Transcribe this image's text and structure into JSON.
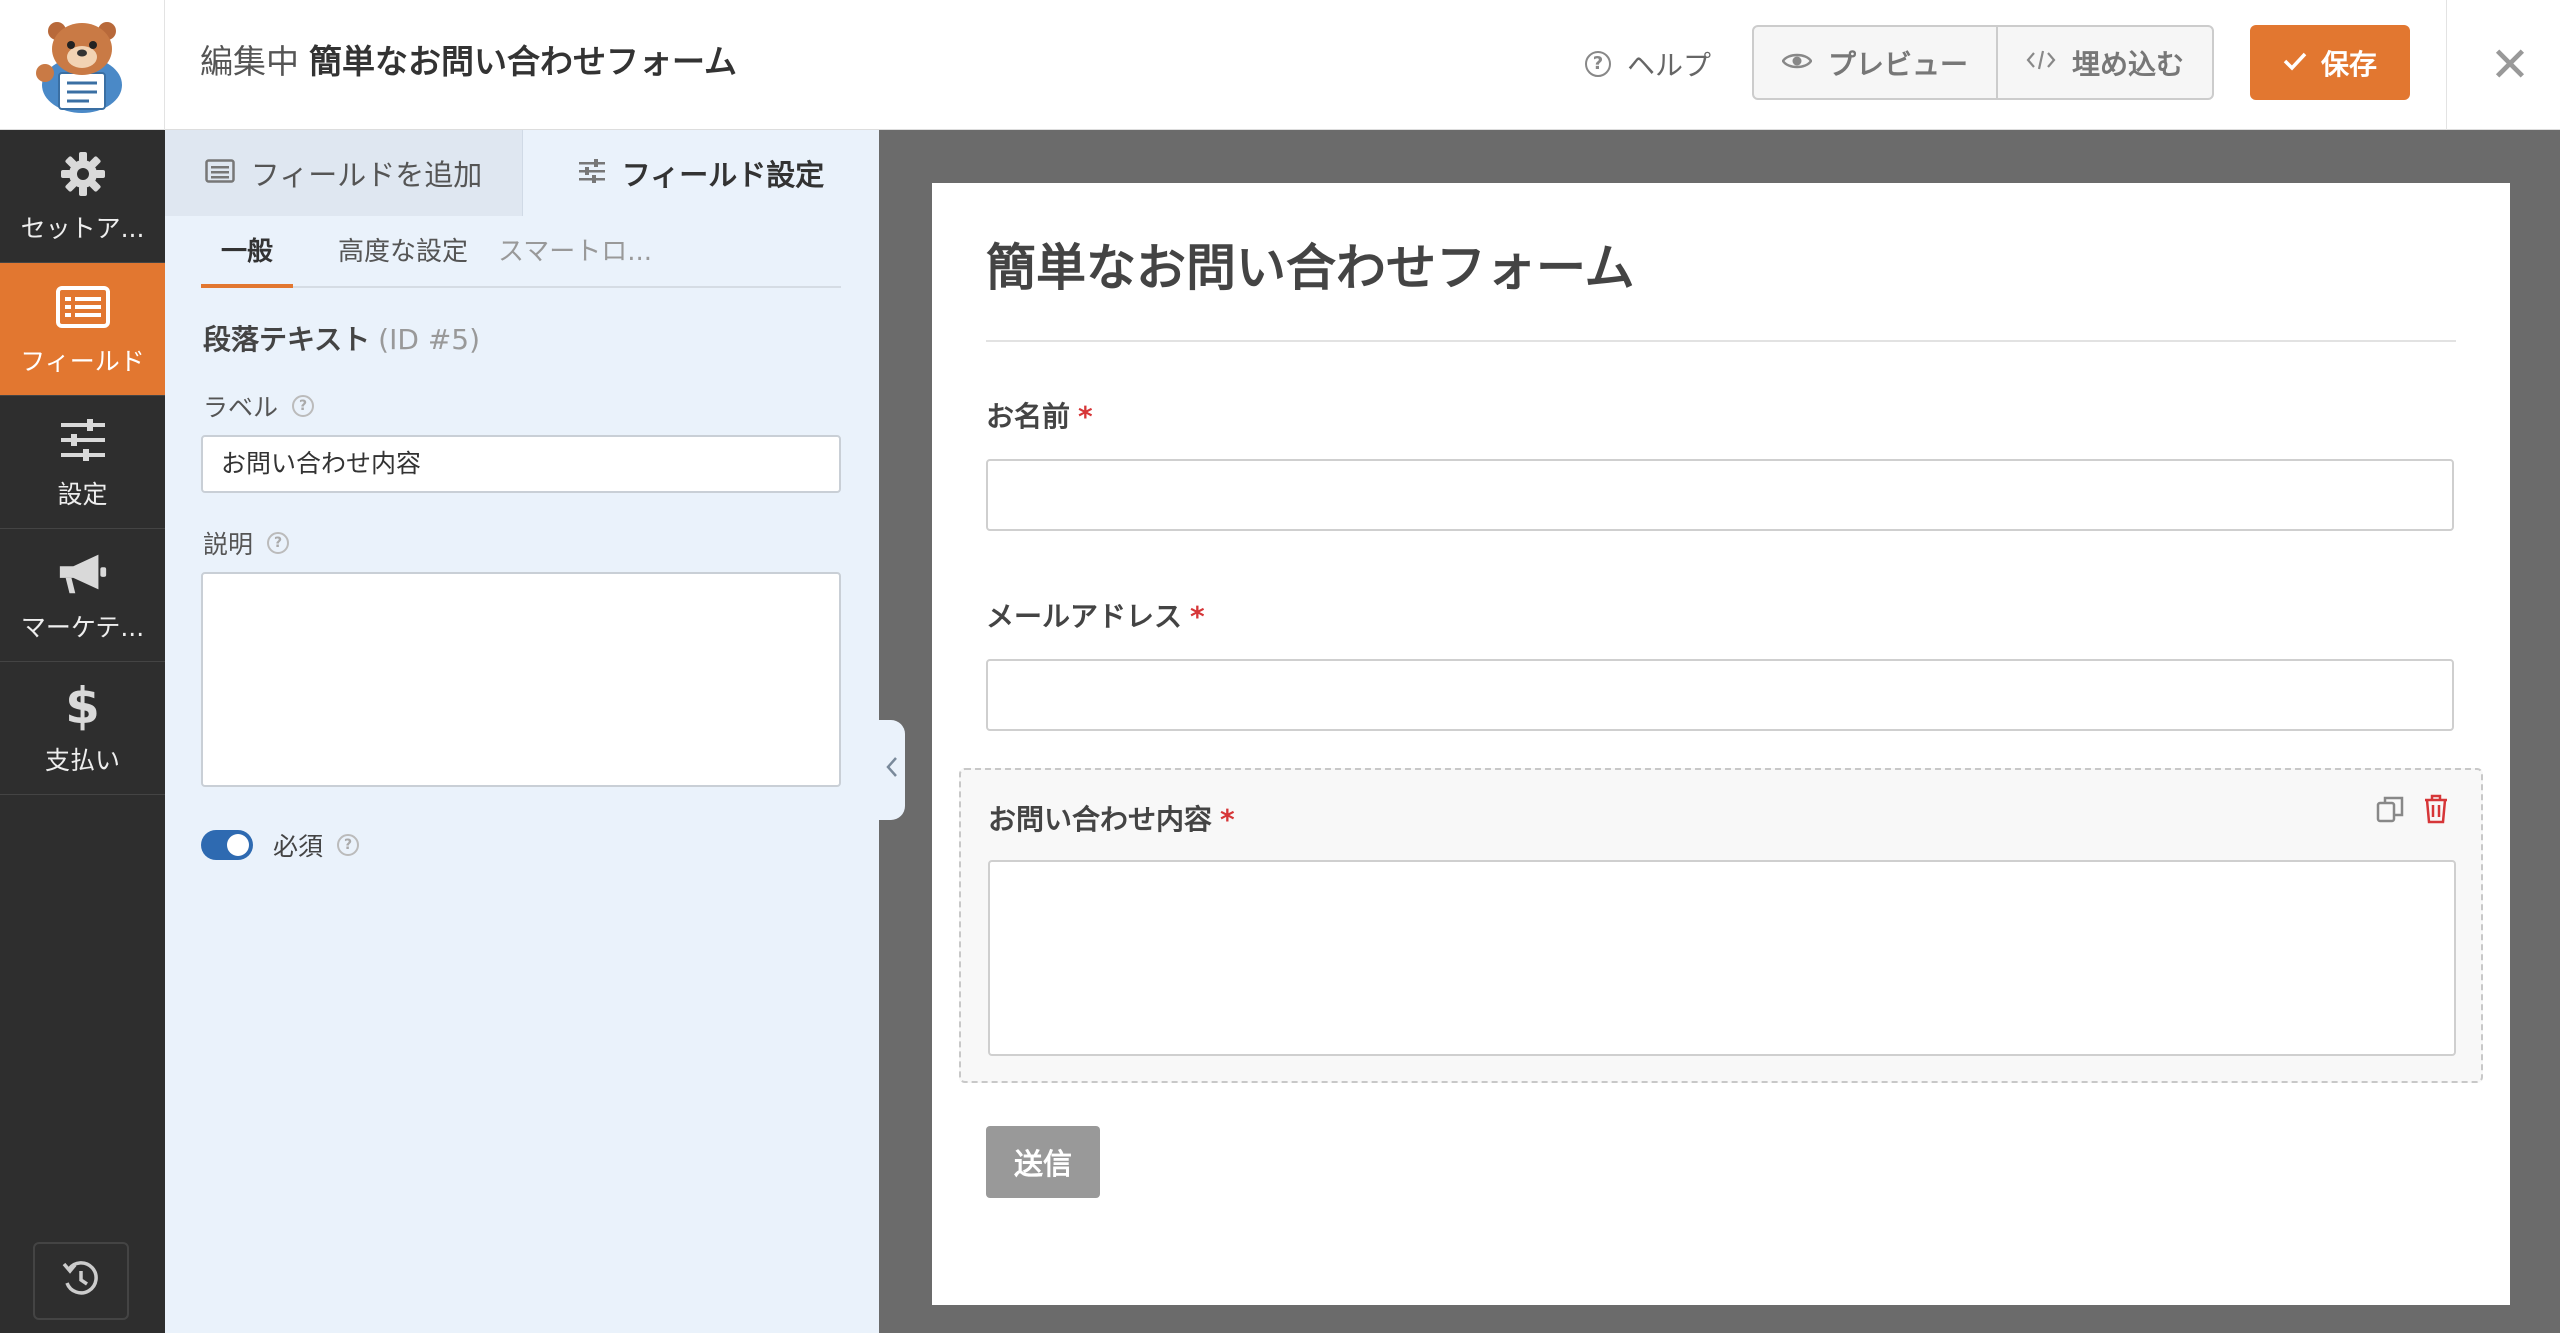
{
  "header": {
    "editing_prefix": "編集中",
    "form_name": "簡単なお問い合わせフォーム",
    "help_label": "ヘルプ",
    "preview_label": "プレビュー",
    "embed_label": "埋め込む",
    "save_label": "保存",
    "close_label": "✕"
  },
  "sidebar": {
    "items": [
      {
        "label": "セットア...",
        "icon": "gear-icon"
      },
      {
        "label": "フィールド",
        "icon": "fields-list-icon",
        "active": true
      },
      {
        "label": "設定",
        "icon": "sliders-icon"
      },
      {
        "label": "マーケテ...",
        "icon": "megaphone-icon"
      },
      {
        "label": "支払い",
        "icon": "dollar-icon"
      }
    ]
  },
  "panel": {
    "tabs": {
      "add_fields": "フィールドを追加",
      "field_options": "フィールド設定"
    },
    "subtabs": {
      "general": "一般",
      "advanced": "高度な設定",
      "smart_logic": "スマートロ..."
    },
    "field_type": "段落テキスト",
    "field_id": "(ID #5)",
    "label_title": "ラベル",
    "label_value": "お問い合わせ内容",
    "description_title": "説明",
    "description_value": "",
    "required_label": "必須",
    "required_on": true
  },
  "form": {
    "title": "簡単なお問い合わせフォーム",
    "fields": [
      {
        "label": "お名前",
        "required": "*"
      },
      {
        "label": "メールアドレス",
        "required": "*"
      },
      {
        "label": "お問い合わせ内容",
        "required": "*"
      }
    ],
    "submit_label": "送信"
  },
  "colors": {
    "accent": "#e27730",
    "toggle_on": "#2e6ab1",
    "required_star": "#d63638",
    "sidebar_bg": "#2e2e2e",
    "panel_bg": "#eaf2fb"
  }
}
